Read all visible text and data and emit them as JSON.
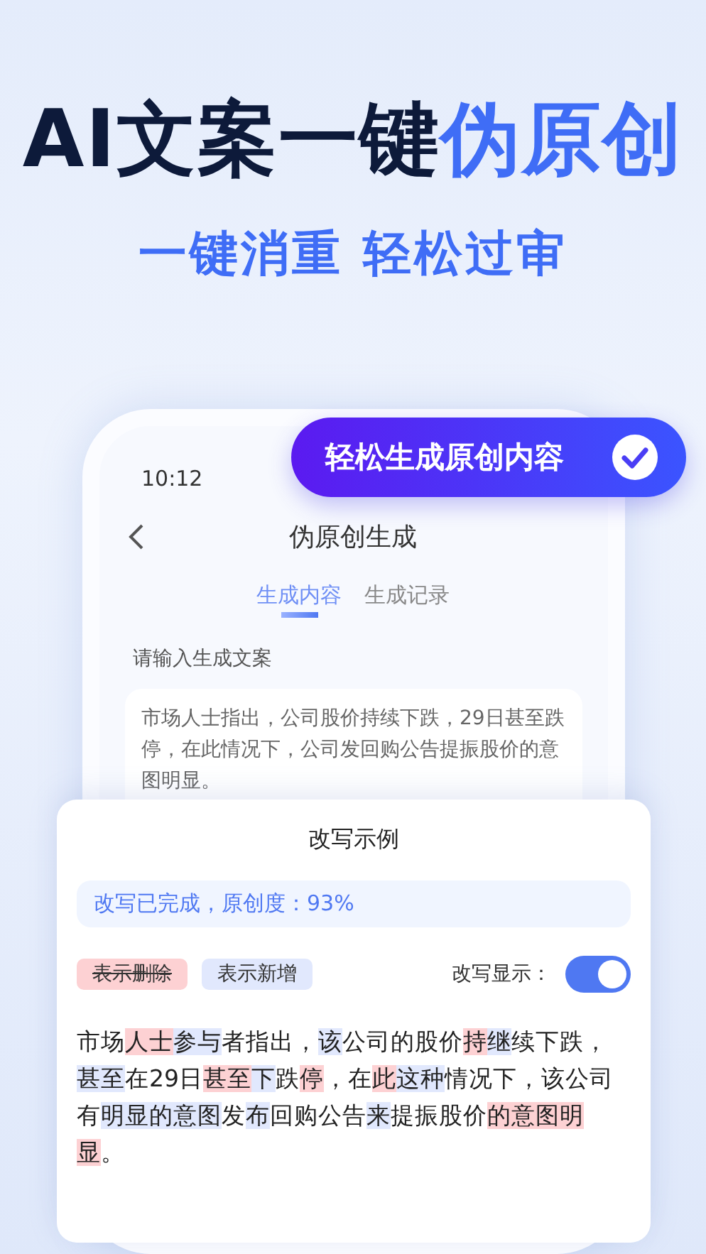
{
  "headline": {
    "dark": "AI文案一键",
    "accent": "伪原创"
  },
  "subtitle": "一键消重 轻松过审",
  "badge": {
    "label": "轻松生成原创内容"
  },
  "phone": {
    "time": "10:12",
    "title": "伪原创生成",
    "tabs": [
      {
        "label": "生成内容",
        "selected": true
      },
      {
        "label": "生成记录",
        "selected": false
      }
    ],
    "input_label": "请输入生成文案",
    "input_value": "市场人士指出，公司股价持续下跌，29日甚至跌停，在此情况下，公司发回购公告提振股价的意图明显。"
  },
  "sheet": {
    "title": "改写示例",
    "status": "改写已完成，原创度：93%",
    "legend": [
      {
        "kind": "deleted",
        "label": "表示删除"
      },
      {
        "kind": "added",
        "label": "表示新增"
      }
    ],
    "toggle": {
      "label": "改写显示：",
      "on": true
    },
    "segments": [
      {
        "kind": "plain",
        "text": "市场"
      },
      {
        "kind": "deleted",
        "text": "人士"
      },
      {
        "kind": "added",
        "text": "参与"
      },
      {
        "kind": "plain",
        "text": "者指出，"
      },
      {
        "kind": "added",
        "text": "该"
      },
      {
        "kind": "plain",
        "text": "公司的股价"
      },
      {
        "kind": "deleted",
        "text": "持"
      },
      {
        "kind": "added",
        "text": "继"
      },
      {
        "kind": "plain",
        "text": "续下跌，"
      },
      {
        "kind": "added",
        "text": "甚至"
      },
      {
        "kind": "plain",
        "text": "在29日"
      },
      {
        "kind": "deleted",
        "text": "甚至"
      },
      {
        "kind": "added",
        "text": "下"
      },
      {
        "kind": "plain",
        "text": "跌"
      },
      {
        "kind": "deleted",
        "text": "停"
      },
      {
        "kind": "plain",
        "text": "，在"
      },
      {
        "kind": "deleted",
        "text": "此"
      },
      {
        "kind": "added",
        "text": "这种"
      },
      {
        "kind": "plain",
        "text": "情况下，该公司"
      },
      {
        "kind": "plain",
        "text": "有"
      },
      {
        "kind": "added",
        "text": "明显的意图"
      },
      {
        "kind": "plain",
        "text": "发"
      },
      {
        "kind": "added",
        "text": "布"
      },
      {
        "kind": "plain",
        "text": "回购公告"
      },
      {
        "kind": "added",
        "text": "来"
      },
      {
        "kind": "plain",
        "text": "提振股价"
      },
      {
        "kind": "deleted",
        "text": "的意图明显"
      },
      {
        "kind": "plain",
        "text": "。"
      }
    ]
  }
}
